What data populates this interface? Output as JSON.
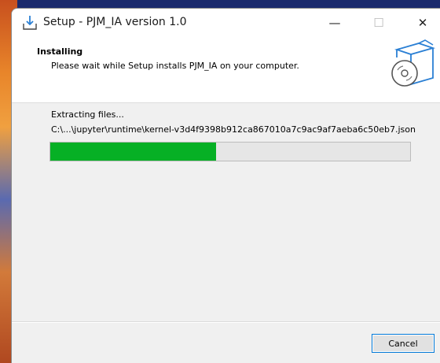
{
  "window": {
    "title": "Setup - PJM_IA version 1.0",
    "controls": {
      "minimize_glyph": "—",
      "maximize_glyph": "☐",
      "close_glyph": "✕"
    }
  },
  "header": {
    "title": "Installing",
    "subtitle": "Please wait while Setup installs PJM_IA on your computer.",
    "graphic_icon": "setup-box-disc-icon"
  },
  "main": {
    "status_label": "Extracting files...",
    "current_file": "C:\\...\\jupyter\\runtime\\kernel-v3d4f9398b912ca867010a7c9ac9af7aeba6c50eb7.json",
    "progress_fraction": 0.46
  },
  "footer": {
    "cancel_label": "Cancel"
  },
  "colors": {
    "progress_fill": "#06b025",
    "accent_border": "#0078d7",
    "icon_blue": "#2a7fd4"
  }
}
